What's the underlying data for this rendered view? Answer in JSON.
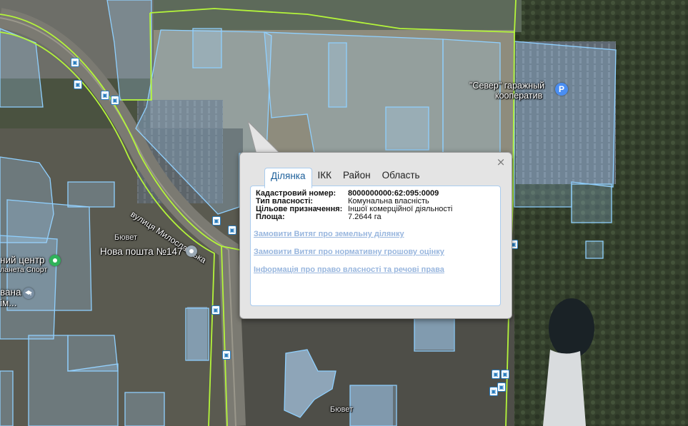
{
  "map": {
    "labels": {
      "street": "вулиця Милославська",
      "garage_line1": "\"Север\" гаражный",
      "garage_line2": "кооператив",
      "nova_poshta": "Нова пошта №147",
      "center_line1": "ний центр",
      "center_line2": "ланета Спорт",
      "school_line1": "вана",
      "school_line2": "ім...",
      "buvet_top": "Бювет",
      "buvet_bottom": "Бювет"
    },
    "colors": {
      "parcel_stroke": "#8fd0ff",
      "parcel_fill": "#a9d8ff",
      "district_line": "#b4f53a",
      "parking_pin": "#4a8ef2",
      "poi_pin_gray": "#9aa8b4",
      "poi_pin_green": "#2fb25a",
      "poi_pin_school": "#7a8fa3"
    },
    "icons": {
      "parking": "parking-pin-icon",
      "nova_poshta": "location-pin-icon",
      "sport_center": "sport-pin-icon",
      "school": "school-icon",
      "transit": "bus-stop-icon"
    },
    "parking_glyph": "P",
    "transit_glyph": "▣"
  },
  "popup": {
    "close_glyph": "×",
    "tabs": [
      "Ділянка",
      "ІКК",
      "Район",
      "Область"
    ],
    "active_tab": "Ділянка",
    "fields": [
      {
        "label": "Кадастровий номер:",
        "value": "8000000000:62:095:0009",
        "bold": true
      },
      {
        "label": "Тип власності:",
        "value": "Комунальна власність",
        "bold": false
      },
      {
        "label": "Цільове призначення:",
        "value": "Іншої комерційної діяльності",
        "bold": false
      },
      {
        "label": "Площа:",
        "value": "7.2644 га",
        "bold": false
      }
    ],
    "links": [
      "Замовити Витяг про земельну ділянку",
      "Замовити Витяг про нормативну грошову оцінку",
      "Інформація про право власності та речові права"
    ]
  }
}
